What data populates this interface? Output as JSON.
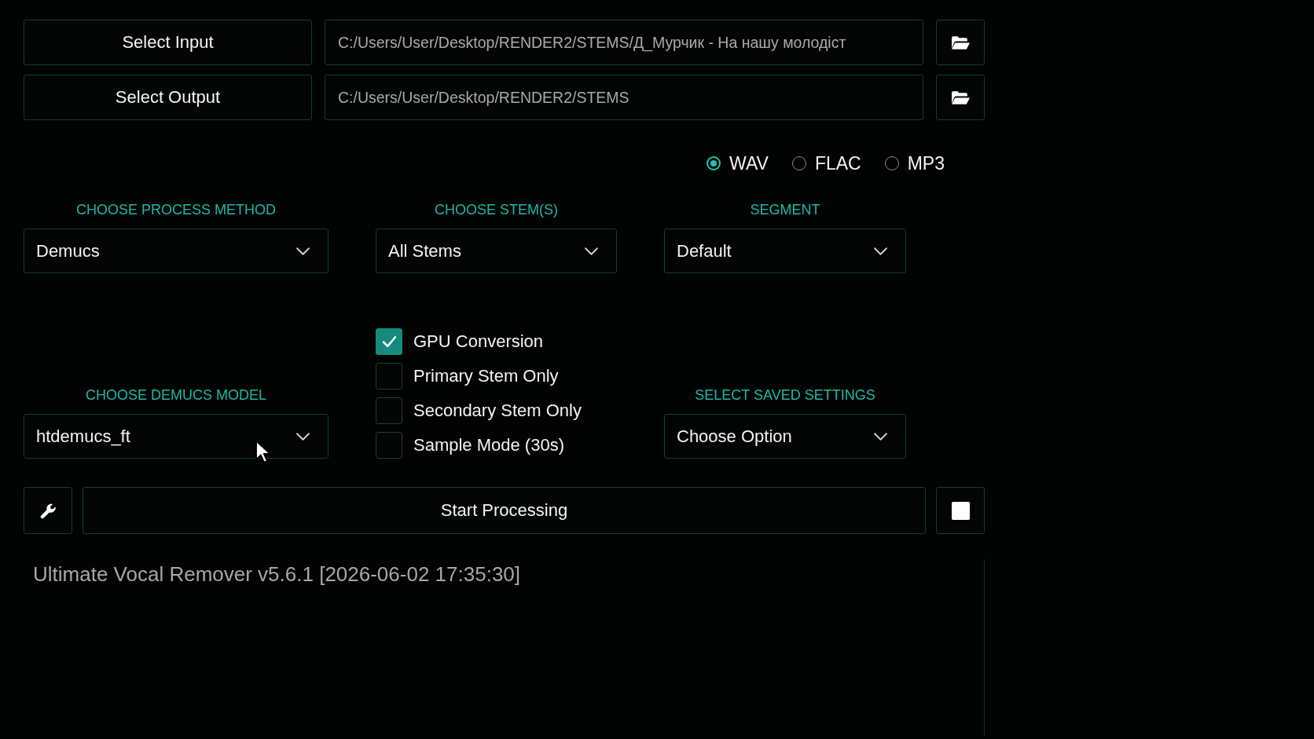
{
  "paths": [
    {
      "button": "Select Input",
      "value": "C:/Users/User/Desktop/RENDER2/STEMS/Д_Мурчик - На нашу молодіст"
    },
    {
      "button": "Select Output",
      "value": "C:/Users/User/Desktop/RENDER2/STEMS"
    }
  ],
  "output_formats": [
    {
      "label": "WAV",
      "selected": true
    },
    {
      "label": "FLAC",
      "selected": false
    },
    {
      "label": "MP3",
      "selected": false
    }
  ],
  "settings_row": [
    {
      "label": "CHOOSE PROCESS METHOD",
      "value": "Demucs"
    },
    {
      "label": "CHOOSE STEM(S)",
      "value": "All Stems"
    },
    {
      "label": "SEGMENT",
      "value": "Default"
    }
  ],
  "model": {
    "label": "CHOOSE DEMUCS MODEL",
    "value": "htdemucs_ft"
  },
  "options": [
    {
      "label": "GPU Conversion",
      "checked": true
    },
    {
      "label": "Primary Stem Only",
      "checked": false
    },
    {
      "label": "Secondary Stem Only",
      "checked": false
    },
    {
      "label": "Sample Mode (30s)",
      "checked": false
    }
  ],
  "saved_settings": {
    "label": "SELECT SAVED SETTINGS",
    "value": "Choose Option"
  },
  "start_button": "Start Processing",
  "console": {
    "lines": [
      "Ultimate Vocal Remover v5.6.1 [2026-06-02 17:35:30]"
    ]
  }
}
